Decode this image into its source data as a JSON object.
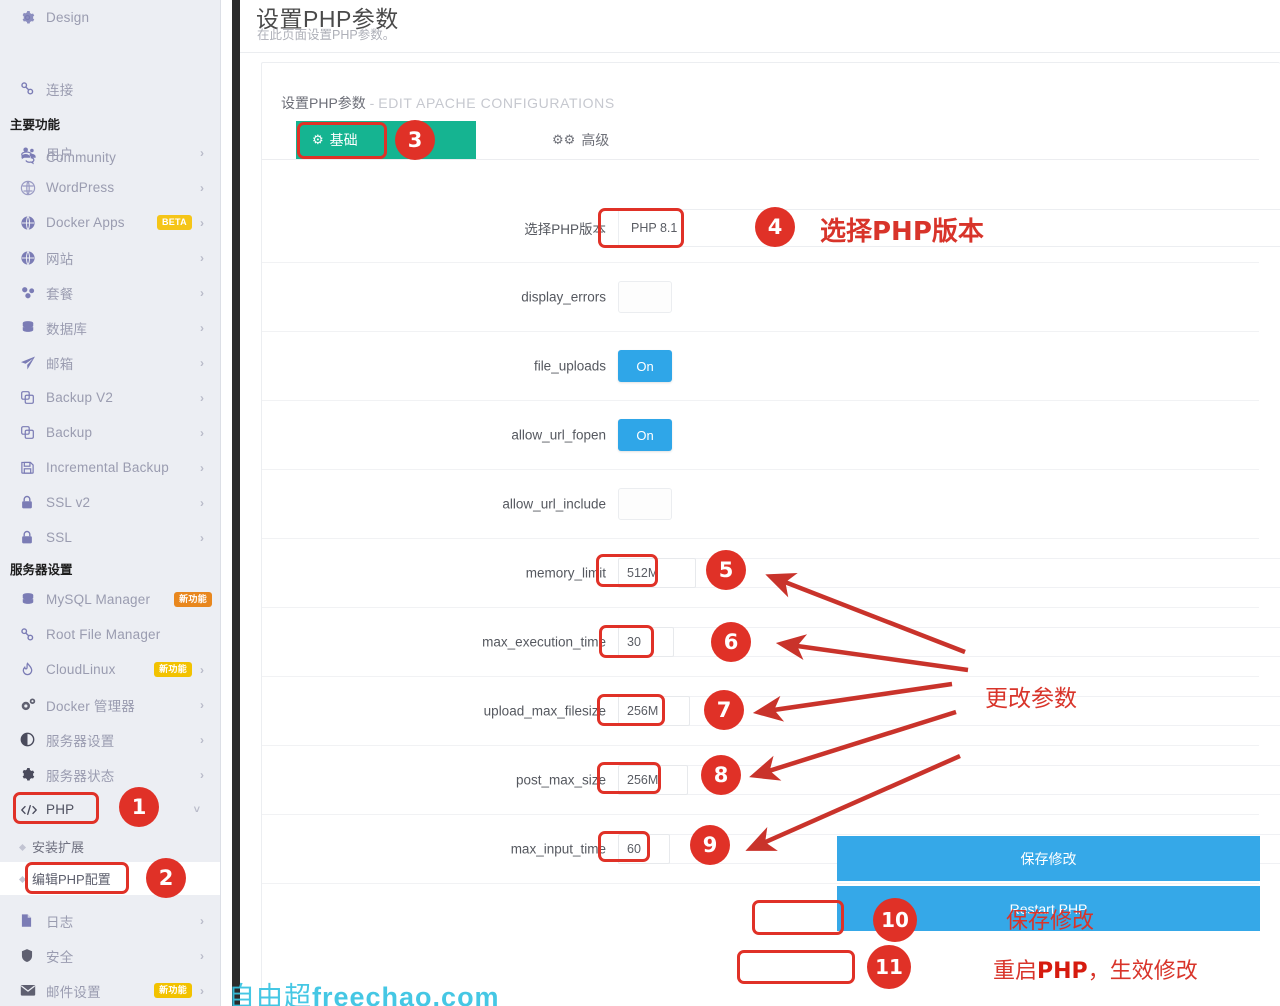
{
  "sidebar": {
    "items": [
      {
        "label": "Design",
        "icon": "gear-icon",
        "chevron": false
      },
      {
        "label": "连接",
        "icon": "link-icon",
        "chevron": false
      },
      {
        "label": "Community",
        "icon": "chat-icon",
        "chevron": false
      }
    ],
    "section_main": "主要功能",
    "main_items": [
      {
        "label": "用户",
        "icon": "users-icon",
        "chevron": true,
        "badge": null
      },
      {
        "label": "WordPress",
        "icon": "wordpress-icon",
        "chevron": true,
        "badge": null
      },
      {
        "label": "Docker Apps",
        "icon": "globe-icon",
        "chevron": true,
        "badge": "BETA",
        "badge_color": "beta"
      },
      {
        "label": "网站",
        "icon": "globe-icon",
        "chevron": true,
        "badge": null
      },
      {
        "label": "套餐",
        "icon": "package-icon",
        "chevron": true,
        "badge": null
      },
      {
        "label": "数据库",
        "icon": "database-icon",
        "chevron": true,
        "badge": null
      },
      {
        "label": "邮箱",
        "icon": "send-icon",
        "chevron": true,
        "badge": null
      },
      {
        "label": "Backup V2",
        "icon": "copy-icon",
        "chevron": true,
        "badge": null
      },
      {
        "label": "Backup",
        "icon": "copy-icon",
        "chevron": true,
        "badge": null
      },
      {
        "label": "Incremental Backup",
        "icon": "save-icon",
        "chevron": true,
        "badge": null
      },
      {
        "label": "SSL v2",
        "icon": "lock-icon",
        "chevron": true,
        "badge": null
      },
      {
        "label": "SSL",
        "icon": "lock-icon",
        "chevron": true,
        "badge": null
      }
    ],
    "section_server": "服务器设置",
    "server_items": [
      {
        "label": "MySQL Manager",
        "icon": "database-icon",
        "chevron": false,
        "badge": "新功能",
        "badge_color": "orange"
      },
      {
        "label": "Root File Manager",
        "icon": "link-icon",
        "chevron": false,
        "badge": null
      },
      {
        "label": "CloudLinux",
        "icon": "flame-icon",
        "chevron": true,
        "badge": "新功能",
        "badge_color": "yellow"
      },
      {
        "label": "Docker 管理器",
        "icon": "gears-icon",
        "chevron": true,
        "badge": null
      },
      {
        "label": "服务器设置",
        "icon": "contrast-icon",
        "chevron": true,
        "badge": null
      },
      {
        "label": "服务器状态",
        "icon": "gear-icon",
        "chevron": true,
        "badge": null
      },
      {
        "label": "PHP",
        "icon": "code-icon",
        "chevron_down": true,
        "badge": null,
        "active": true
      }
    ],
    "php_sub_items": [
      {
        "label": "安装扩展",
        "active": false
      },
      {
        "label": "编辑PHP配置",
        "active": true
      }
    ],
    "after_items": [
      {
        "label": "日志",
        "icon": "file-icon",
        "chevron": true,
        "badge": null
      },
      {
        "label": "安全",
        "icon": "shield-icon",
        "chevron": true,
        "badge": null
      },
      {
        "label": "邮件设置",
        "icon": "mail-icon",
        "chevron": true,
        "badge": "新功能",
        "badge_color": "yellow"
      }
    ]
  },
  "page": {
    "title": "设置PHP参数",
    "subtitle": "在此页面设置PHP参数。",
    "card_title_cn": "设置PHP参数",
    "card_title_dash": " - ",
    "card_title_en": "EDIT APACHE CONFIGURATIONS"
  },
  "tabs": [
    {
      "label": "基础",
      "icon": "gear-icon",
      "active": true
    },
    {
      "label": "高级",
      "icon": "gears-icon",
      "active": false
    }
  ],
  "form": {
    "php_version": {
      "label": "选择PHP版本",
      "value": "PHP 8.1",
      "type": "select"
    },
    "fields": [
      {
        "label": "display_errors",
        "value": "",
        "type": "toggle",
        "state": "off"
      },
      {
        "label": "file_uploads",
        "value": "On",
        "type": "toggle",
        "state": "on"
      },
      {
        "label": "allow_url_fopen",
        "value": "On",
        "type": "toggle",
        "state": "on"
      },
      {
        "label": "allow_url_include",
        "value": "",
        "type": "toggle",
        "state": "off"
      },
      {
        "label": "memory_limit",
        "value": "512M",
        "type": "text"
      },
      {
        "label": "max_execution_time",
        "value": "30",
        "type": "text"
      },
      {
        "label": "upload_max_filesize",
        "value": "256M",
        "type": "text"
      },
      {
        "label": "post_max_size",
        "value": "256M",
        "type": "text"
      },
      {
        "label": "max_input_time",
        "value": "60",
        "type": "text"
      }
    ],
    "save_button": "保存修改",
    "restart_button": "Restart PHP"
  },
  "annotations": {
    "numbers": [
      "1",
      "2",
      "3",
      "4",
      "5",
      "6",
      "7",
      "8",
      "9",
      "10",
      "11"
    ],
    "texts": {
      "select_php": "选择PHP版本",
      "change_params": "更改参数",
      "save_changes": "保存修改",
      "restart_php_prefix": "重启",
      "restart_php_bold": "PHP",
      "restart_php_suffix": "，生效修改"
    }
  },
  "watermark": {
    "cn": "自由超",
    "en": "freechao.com"
  },
  "colors": {
    "accent_teal": "#15b491",
    "button_blue": "#35a8e8",
    "annotation_red": "#e03127",
    "badge_orange": "#e8871e",
    "badge_yellow": "#f2c200"
  }
}
